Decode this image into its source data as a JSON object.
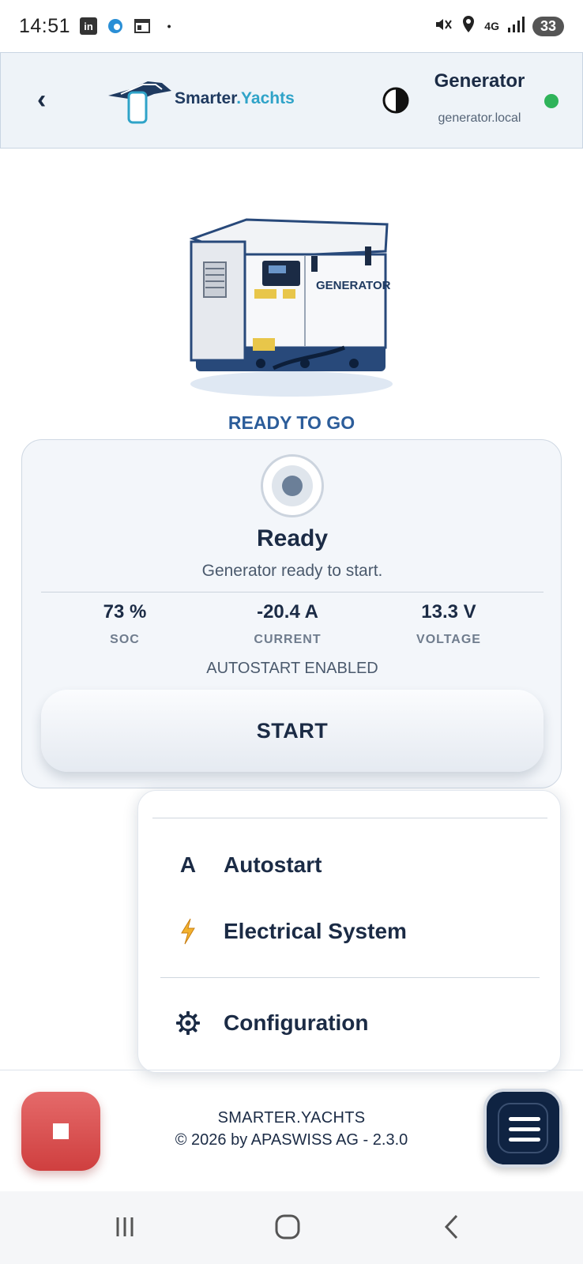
{
  "status_bar": {
    "time": "14:51",
    "network": "4G",
    "battery": "33"
  },
  "header": {
    "logo_text_main": "Smarter",
    "logo_text_accent": ".Yachts",
    "device_name": "Generator",
    "device_host": "generator.local",
    "online_color": "#2fb35a"
  },
  "generator": {
    "state_title": "READY TO GO",
    "image_label": "GENERATOR"
  },
  "status_card": {
    "status": "Ready",
    "description": "Generator ready to start.",
    "metrics": [
      {
        "value": "73 %",
        "label": "SOC"
      },
      {
        "value": "-20.4 A",
        "label": "CURRENT"
      },
      {
        "value": "13.3 V",
        "label": "VOLTAGE"
      }
    ],
    "autostart_note": "AUTOSTART ENABLED",
    "start_label": "START"
  },
  "menu": {
    "items": [
      {
        "icon": "A",
        "label": "Autostart"
      },
      {
        "icon": "lightning-icon",
        "label": "Electrical System"
      },
      {
        "icon": "gear-icon",
        "label": "Configuration"
      }
    ]
  },
  "footer": {
    "brand": "SMARTER.YACHTS",
    "copyright": "© 2026 by APASWISS AG - 2.3.0"
  },
  "colors": {
    "accent": "#2c5d9a",
    "stop": "#d94b4b",
    "menu_button": "#0f2342"
  }
}
